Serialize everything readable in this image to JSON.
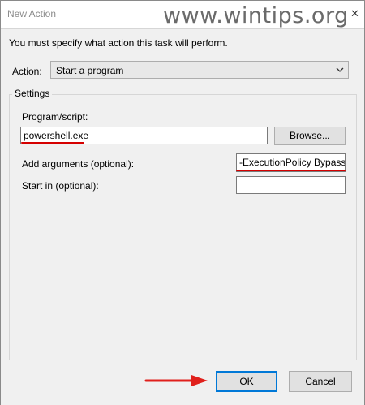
{
  "window": {
    "title": "New Action",
    "close_glyph": "✕",
    "watermark": "www.wintips.org"
  },
  "dialog": {
    "intro": "You must specify what action this task will perform.",
    "action_label": "Action:",
    "action_value": "Start a program",
    "settings_label": "Settings",
    "program_label": "Program/script:",
    "program_value": "powershell.exe",
    "browse_label": "Browse...",
    "args_label": "Add arguments (optional):",
    "args_value": "-ExecutionPolicy Bypass",
    "startin_label": "Start in (optional):",
    "startin_value": ""
  },
  "buttons": {
    "ok": "OK",
    "cancel": "Cancel"
  },
  "colors": {
    "highlight_underline": "#d50000",
    "arrow": "#e0201c",
    "ok_focus": "#0078d7"
  },
  "icons": {
    "dropdown": "chevron-down-icon",
    "annotation": "red-arrow-icon"
  }
}
